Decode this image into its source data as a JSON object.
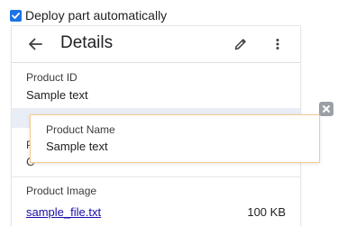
{
  "deploy": {
    "label": "Deploy part automatically",
    "checked": true
  },
  "panel": {
    "title": "Details",
    "icons": {
      "back": "arrow-left-icon",
      "edit": "pencil-icon",
      "more": "more-vert-icon"
    },
    "fields": [
      {
        "label": "Product ID",
        "value": "Sample text"
      },
      {
        "label": "P",
        "value": "C"
      }
    ],
    "image": {
      "label": "Product Image",
      "file_name": "sample_file.txt",
      "file_size": "100 KB"
    }
  },
  "overlay": {
    "label": "Product Name",
    "value": "Sample text",
    "close_icon": "close-icon"
  },
  "colors": {
    "accent": "#1a73e8",
    "overlay_border": "#f5c98f",
    "highlight": "#e9eef6",
    "close_bg": "#9aa0a6"
  }
}
